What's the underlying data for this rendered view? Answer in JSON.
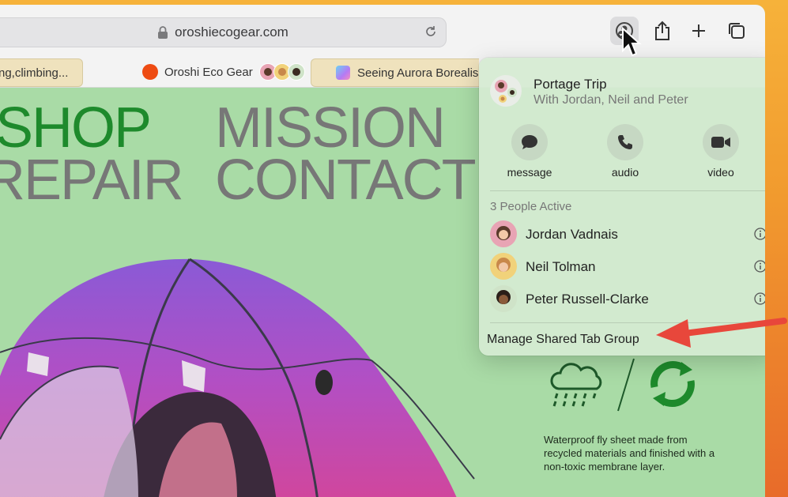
{
  "toolbar": {
    "url": "oroshiecogear.com",
    "buttons": [
      "share-group-button",
      "share-button",
      "new-tab-button",
      "tab-overview-button"
    ]
  },
  "tabs": [
    {
      "title": "ng,climbing..."
    },
    {
      "title": "Oroshi Eco Gear",
      "active": true
    },
    {
      "title": "Seeing Aurora Borealis"
    }
  ],
  "page": {
    "nav": {
      "shop": "SHOP",
      "mission": "MISSION",
      "repair": "REPAIR",
      "contact": "CONTACT"
    },
    "caption": "Waterproof fly sheet made from recycled materials and finished with a non-toxic membrane layer."
  },
  "popover": {
    "group_title": "Portage Trip",
    "group_subtitle": "With Jordan, Neil and Peter",
    "actions": [
      {
        "label": "message",
        "icon": "message-icon"
      },
      {
        "label": "audio",
        "icon": "phone-icon"
      },
      {
        "label": "video",
        "icon": "video-icon"
      }
    ],
    "active_header": "3 People Active",
    "people": [
      {
        "name": "Jordan Vadnais",
        "color": "#e8a4b4"
      },
      {
        "name": "Neil Tolman",
        "color": "#f1d27a"
      },
      {
        "name": "Peter Russell-Clarke",
        "color": "#cfe3c8"
      }
    ],
    "manage_label": "Manage Shared Tab Group"
  },
  "colors": {
    "accent_green": "#1e8a2c",
    "arrow_red": "#e8473b",
    "page_bg": "#a9dba6"
  }
}
